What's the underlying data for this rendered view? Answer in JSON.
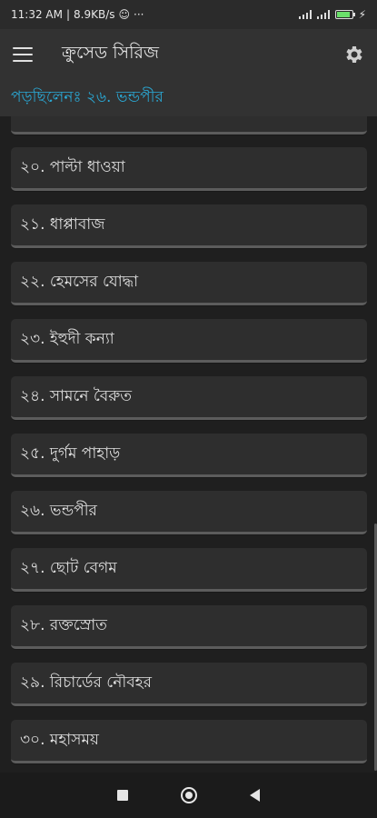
{
  "status": {
    "time": "11:32 AM",
    "speed": "8.9KB/s",
    "battery": "85"
  },
  "app": {
    "title": "ক্রুসেড সিরিজ"
  },
  "reading": {
    "label": "পড়ছিলেনঃ ২৬. ভন্ডপীর"
  },
  "chapters": [
    "২০. পাল্টা ধাওয়া",
    "২১. ধাপ্পাবাজ",
    "২২. হেমসের যোদ্ধা",
    "২৩. ইহুদী কন্যা",
    "২৪. সামনে বৈরুত",
    "২৫. দুর্গম পাহাড়",
    "২৬. ভন্ডপীর",
    "২৭. ছোট বেগম",
    "২৮. রক্তস্রোত",
    "২৯. রিচার্ডের নৌবহর",
    "৩০. মহাসময়"
  ]
}
